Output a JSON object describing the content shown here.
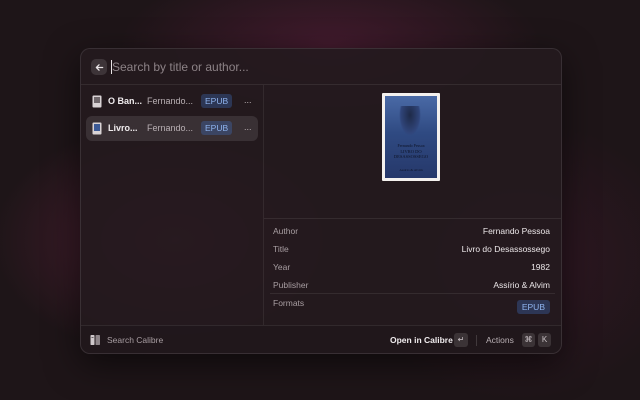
{
  "search": {
    "placeholder": "Search by title or author...",
    "value": ""
  },
  "results": [
    {
      "title": "O Ban...",
      "author": "Fernando...",
      "format": "EPUB",
      "more": "...",
      "selected": false
    },
    {
      "title": "Livro...",
      "author": "Fernando...",
      "format": "EPUB",
      "more": "...",
      "selected": true
    }
  ],
  "detail": {
    "cover": {
      "author": "Fernando Pessoa",
      "title": "LIVRO DO DESASSOSSEGO",
      "publisher": "Assírio & Alvim"
    },
    "fields": [
      {
        "label": "Author",
        "value": "Fernando Pessoa"
      },
      {
        "label": "Title",
        "value": "Livro do Desassossego"
      },
      {
        "label": "Year",
        "value": "1982"
      },
      {
        "label": "Publisher",
        "value": "Assírio & Alvim"
      }
    ],
    "formats_label": "Formats",
    "formats": [
      "EPUB"
    ]
  },
  "footer": {
    "extension_label": "Search Calibre",
    "primary_action": "Open in Calibre",
    "primary_key": "↵",
    "actions_label": "Actions",
    "actions_keys": [
      "⌘",
      "K"
    ]
  },
  "colors": {
    "badge_bg": "#2e3f66",
    "badge_text": "#8fb4ef",
    "background": "#1e1518"
  }
}
